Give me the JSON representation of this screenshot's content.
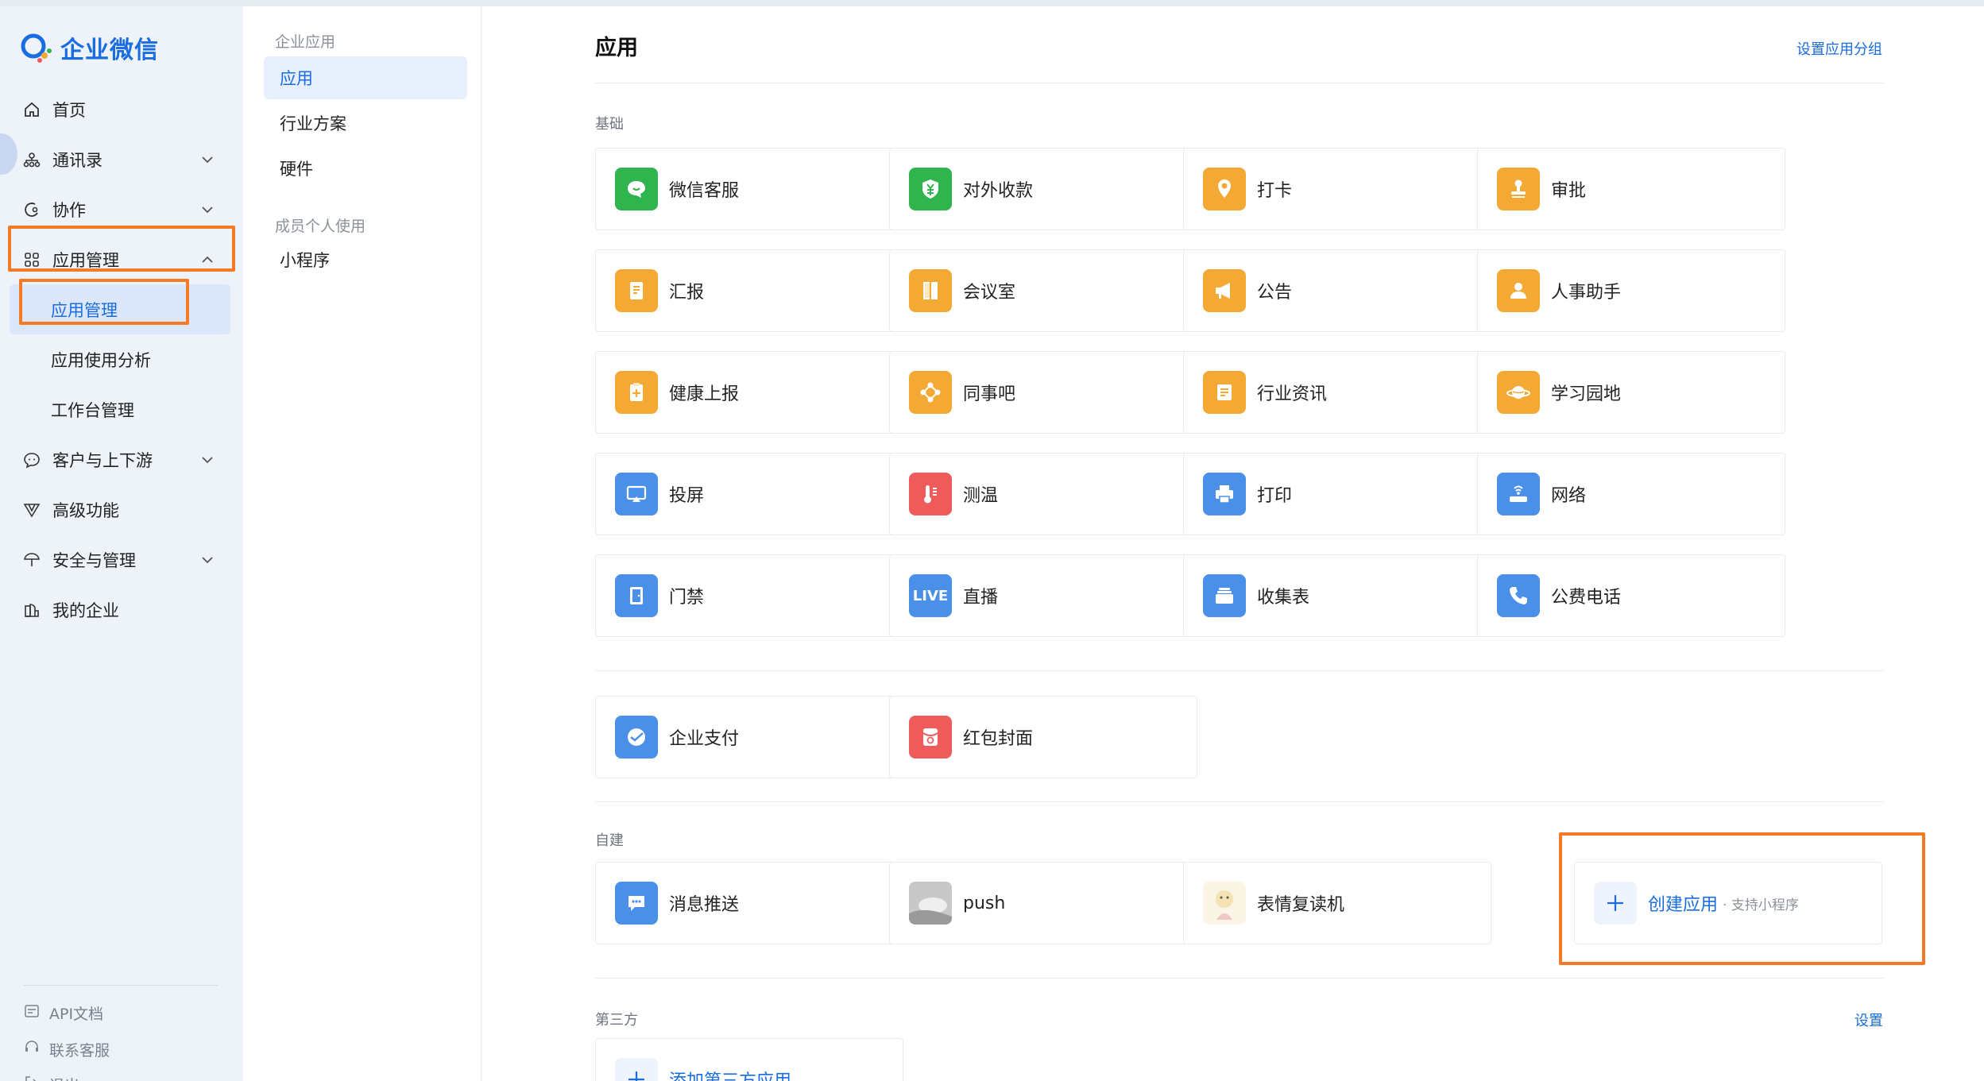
{
  "brand": {
    "name": "企业微信"
  },
  "nav": {
    "home": "首页",
    "contacts": "通讯录",
    "collab": "协作",
    "app_mgmt": "应用管理",
    "sub_app_mgmt": "应用管理",
    "sub_usage": "应用使用分析",
    "sub_workbench": "工作台管理",
    "customers": "客户与上下游",
    "advanced": "高级功能",
    "security": "安全与管理",
    "my_company": "我的企业",
    "api_docs": "API文档",
    "support": "联系客服",
    "logout": "退出"
  },
  "col2": {
    "group_enterprise": "企业应用",
    "apps": "应用",
    "industry": "行业方案",
    "hardware": "硬件",
    "group_personal": "成员个人使用",
    "mini_program": "小程序"
  },
  "main": {
    "title": "应用",
    "set_groups": "设置应用分组",
    "section_basic": "基础",
    "section_custom": "自建",
    "section_third": "第三方",
    "third_settings": "设置",
    "create_app": "创建应用",
    "create_app_sub": "· 支持小程序",
    "add_third": "添加第三方应用"
  },
  "basic_apps": [
    {
      "label": "微信客服",
      "icon": "chat-bubble-icon",
      "color": "#2fb44e"
    },
    {
      "label": "对外收款",
      "icon": "yuan-shield-icon",
      "color": "#2fb44e"
    },
    {
      "label": "打卡",
      "icon": "location-pin-icon",
      "color": "#f4a935"
    },
    {
      "label": "审批",
      "icon": "stamp-icon",
      "color": "#f4a935"
    },
    {
      "label": "汇报",
      "icon": "report-doc-icon",
      "color": "#f4a935"
    },
    {
      "label": "会议室",
      "icon": "door-icon",
      "color": "#f4a935"
    },
    {
      "label": "公告",
      "icon": "megaphone-icon",
      "color": "#f4a935"
    },
    {
      "label": "人事助手",
      "icon": "person-icon",
      "color": "#f4a935"
    },
    {
      "label": "健康上报",
      "icon": "clipboard-plus-icon",
      "color": "#f4a935"
    },
    {
      "label": "同事吧",
      "icon": "network-nodes-icon",
      "color": "#f4a935"
    },
    {
      "label": "行业资讯",
      "icon": "news-doc-icon",
      "color": "#f4a935"
    },
    {
      "label": "学习园地",
      "icon": "planet-icon",
      "color": "#f4a935"
    },
    {
      "label": "投屏",
      "icon": "screen-cast-icon",
      "color": "#4a90e8"
    },
    {
      "label": "测温",
      "icon": "thermometer-icon",
      "color": "#ef5b5b"
    },
    {
      "label": "打印",
      "icon": "printer-icon",
      "color": "#4a90e8"
    },
    {
      "label": "网络",
      "icon": "router-icon",
      "color": "#4a90e8"
    },
    {
      "label": "门禁",
      "icon": "access-door-icon",
      "color": "#4a90e8"
    },
    {
      "label": "直播",
      "icon": "live-icon",
      "color": "#4a90e8",
      "glyph": "LIVE"
    },
    {
      "label": "收集表",
      "icon": "stack-form-icon",
      "color": "#4a90e8"
    },
    {
      "label": "公费电话",
      "icon": "phone-icon",
      "color": "#4a90e8"
    }
  ],
  "extra_apps": [
    {
      "label": "企业支付",
      "icon": "pay-swoosh-icon",
      "color": "#4a90e8"
    },
    {
      "label": "红包封面",
      "icon": "red-envelope-icon",
      "color": "#ef5b5b"
    }
  ],
  "custom_apps": [
    {
      "label": "消息推送",
      "icon": "message-push-icon",
      "color": "#4a90e8"
    },
    {
      "label": "push",
      "icon": "photo-thumbnail-icon",
      "color": "#b9b9b9"
    },
    {
      "label": "表情复读机",
      "icon": "cartoon-thumbnail-icon",
      "color": "#f3e7c6"
    }
  ]
}
